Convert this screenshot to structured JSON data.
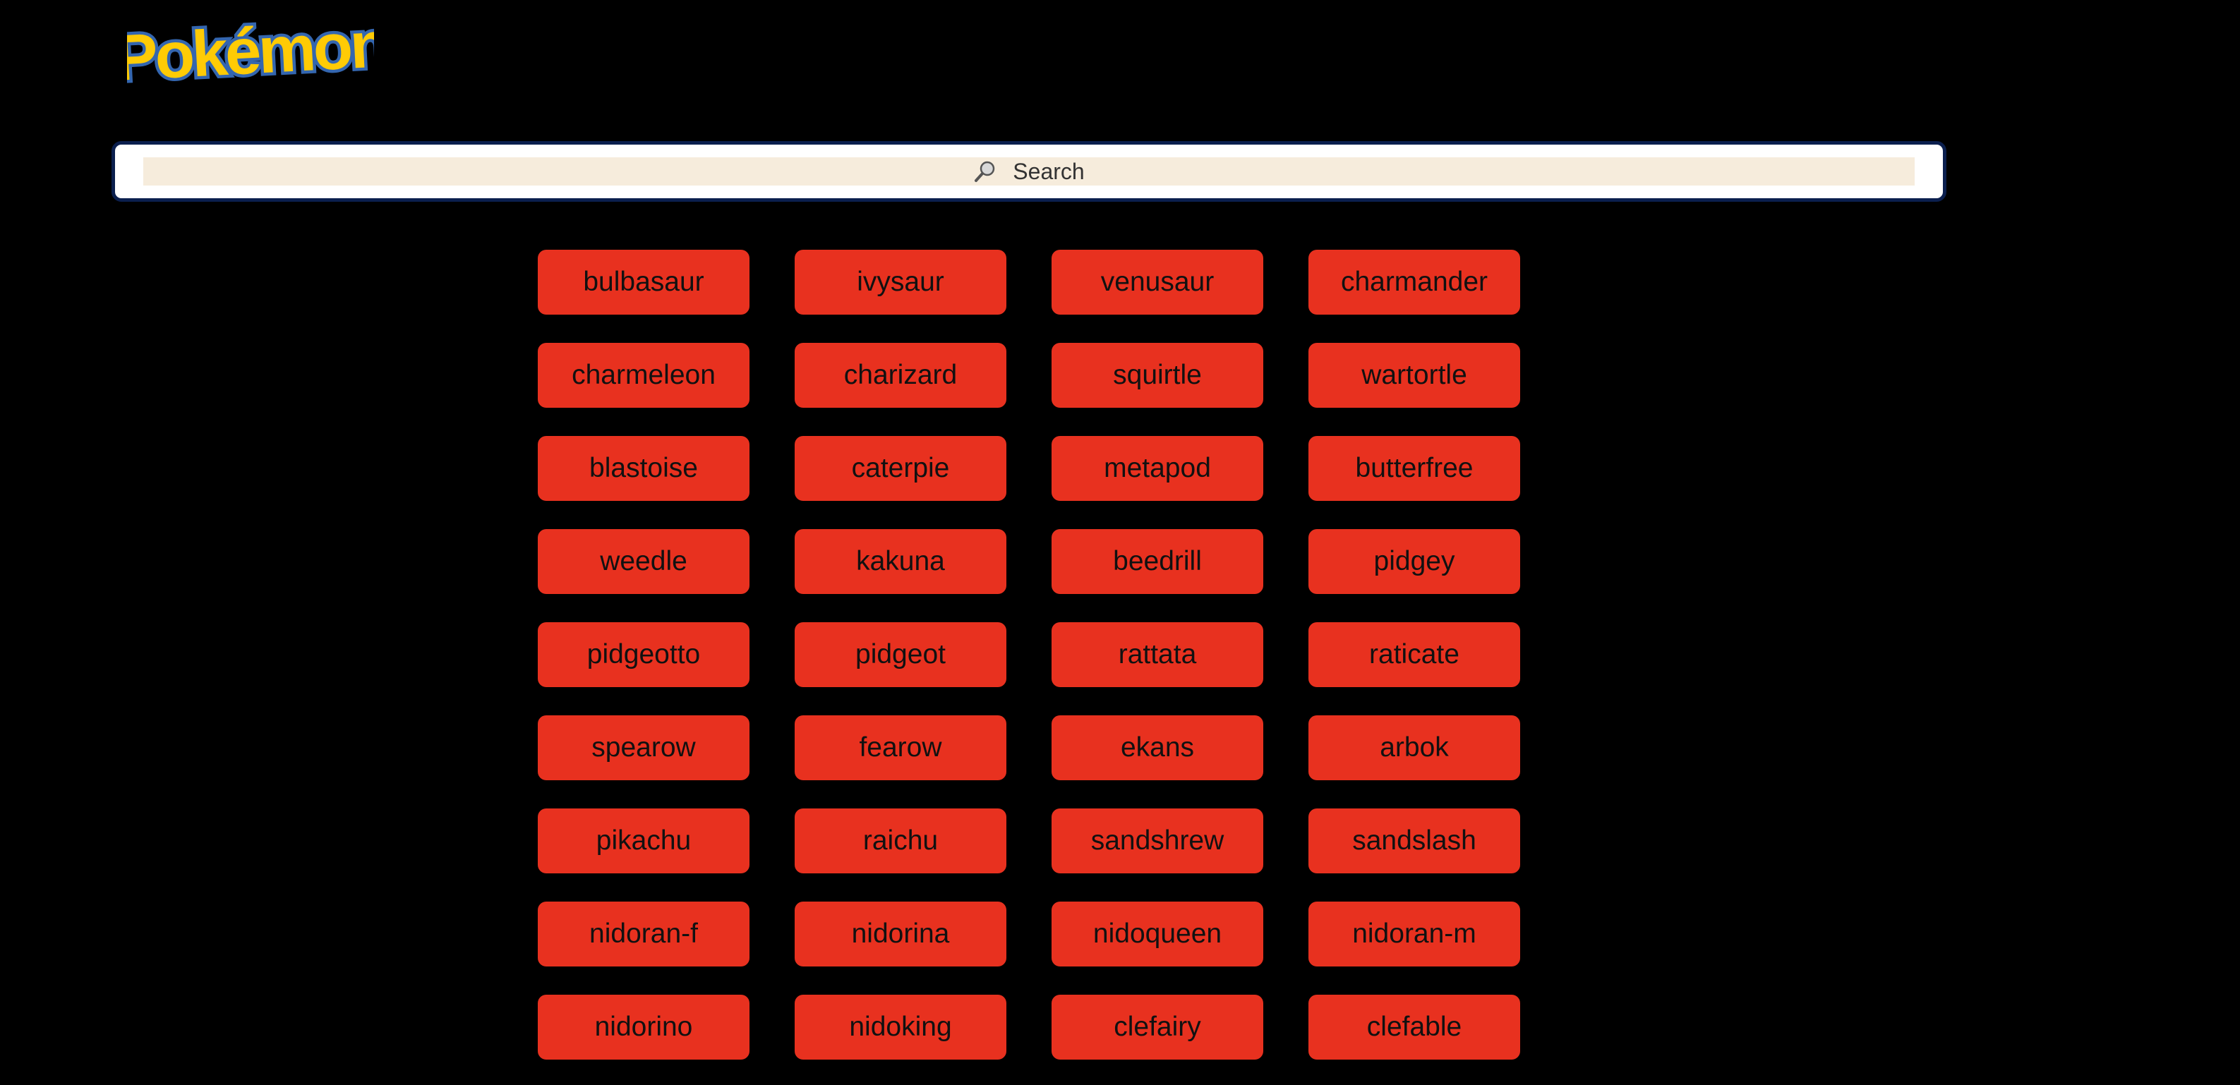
{
  "brand": {
    "logo_text": "Pokémon"
  },
  "search": {
    "placeholder": "Search",
    "icon": "search-icon"
  },
  "pokemon": [
    "bulbasaur",
    "ivysaur",
    "venusaur",
    "charmander",
    "charmeleon",
    "charizard",
    "squirtle",
    "wartortle",
    "blastoise",
    "caterpie",
    "metapod",
    "butterfree",
    "weedle",
    "kakuna",
    "beedrill",
    "pidgey",
    "pidgeotto",
    "pidgeot",
    "rattata",
    "raticate",
    "spearow",
    "fearow",
    "ekans",
    "arbok",
    "pikachu",
    "raichu",
    "sandshrew",
    "sandslash",
    "nidoran-f",
    "nidorina",
    "nidoqueen",
    "nidoran-m",
    "nidorino",
    "nidoking",
    "clefairy",
    "clefable"
  ],
  "colors": {
    "background": "#000000",
    "button": "#e8311f",
    "search_border": "#0b1f4e",
    "search_field": "#f6ecdc",
    "logo_yellow": "#ffcb05",
    "logo_blue": "#3466af"
  }
}
